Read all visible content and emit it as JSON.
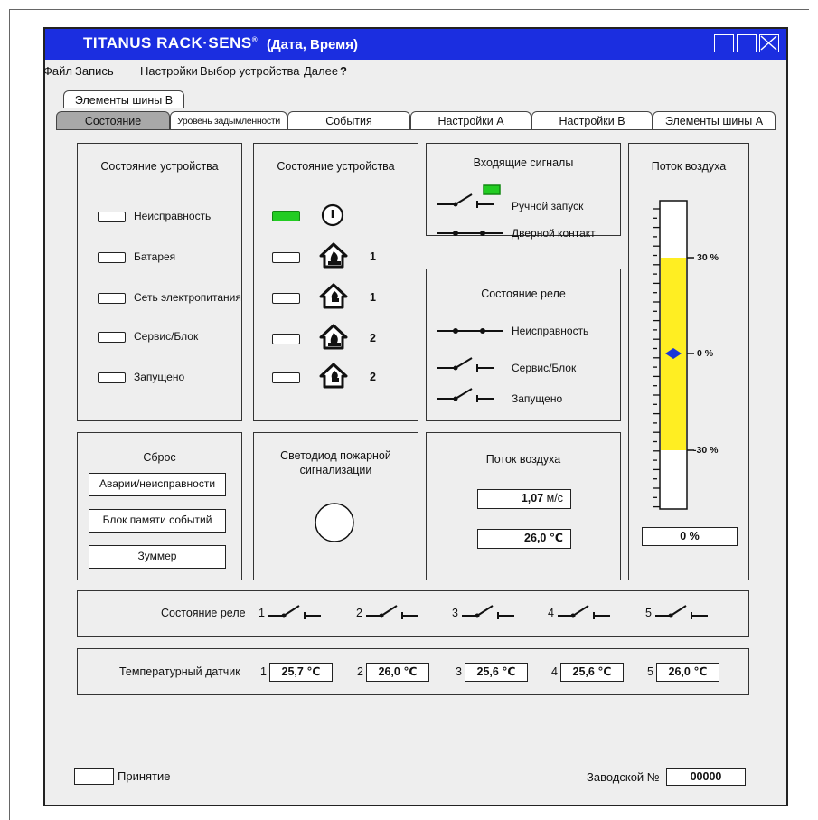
{
  "window": {
    "brand": "TITANUS RACK·SENS",
    "brand_mark": "®",
    "title": "(Дата, Время)",
    "accent_color": "#1b2ee0"
  },
  "menu": {
    "file": "Файл",
    "record": "Запись",
    "settings": "Настройки",
    "device": "Выбор устройства",
    "next": "Далее",
    "help": "?"
  },
  "tabs": {
    "bus_b": "Элементы шины В",
    "status": "Состояние",
    "smoke": "Уровень задымленности",
    "events": "События",
    "settings_a": "Настройки А",
    "settings_b": "Настройки В",
    "bus_a": "Элементы шины А"
  },
  "device_status": {
    "title": "Состояние устройства",
    "items": [
      "Неисправность",
      "Батарея",
      "Сеть электропитания",
      "Сервис/Блок",
      "Запущено"
    ]
  },
  "device_status2": {
    "title": "Состояние устройства",
    "numbers": [
      "1",
      "1",
      "2",
      "2"
    ],
    "active_color": "#22cc22"
  },
  "inputs": {
    "title": "Входящие сигналы",
    "manual": "Ручной запуск",
    "door": "Дверной контакт"
  },
  "relay_state": {
    "title": "Состояние реле",
    "fault": "Неисправность",
    "service": "Сервис/Блок",
    "started": "Запущено"
  },
  "airflow_gauge": {
    "title": "Поток воздуха",
    "label_top": "30 %",
    "label_mid": "0 %",
    "label_bot": "-30 %",
    "value": "0 %",
    "fill_color": "#ffee22",
    "marker_color": "#1a35d8"
  },
  "reset": {
    "title": "Сброс",
    "alarms": "Аварии/неисправности",
    "memory": "Блок памяти событий",
    "buzzer": "Зуммер"
  },
  "fire_led": {
    "title_line1": "Светодиод пожарной",
    "title_line2": "сигнализации"
  },
  "airflow": {
    "title": "Поток воздуха",
    "speed": "1,07",
    "speed_unit": "м/с",
    "temp": "26,0 ℃"
  },
  "relays": {
    "label": "Состояние реле",
    "numbers": [
      "1",
      "2",
      "3",
      "4",
      "5"
    ]
  },
  "temp_sensors": {
    "label": "Температурный датчик",
    "numbers": [
      "1",
      "2",
      "3",
      "4",
      "5"
    ],
    "values": [
      "25,7 ℃",
      "26,0 ℃",
      "25,6 ℃",
      "25,6 ℃",
      "26,0 ℃"
    ]
  },
  "footer": {
    "accept": "Принятие",
    "serial_label": "Заводской №",
    "serial_value": "00000"
  }
}
